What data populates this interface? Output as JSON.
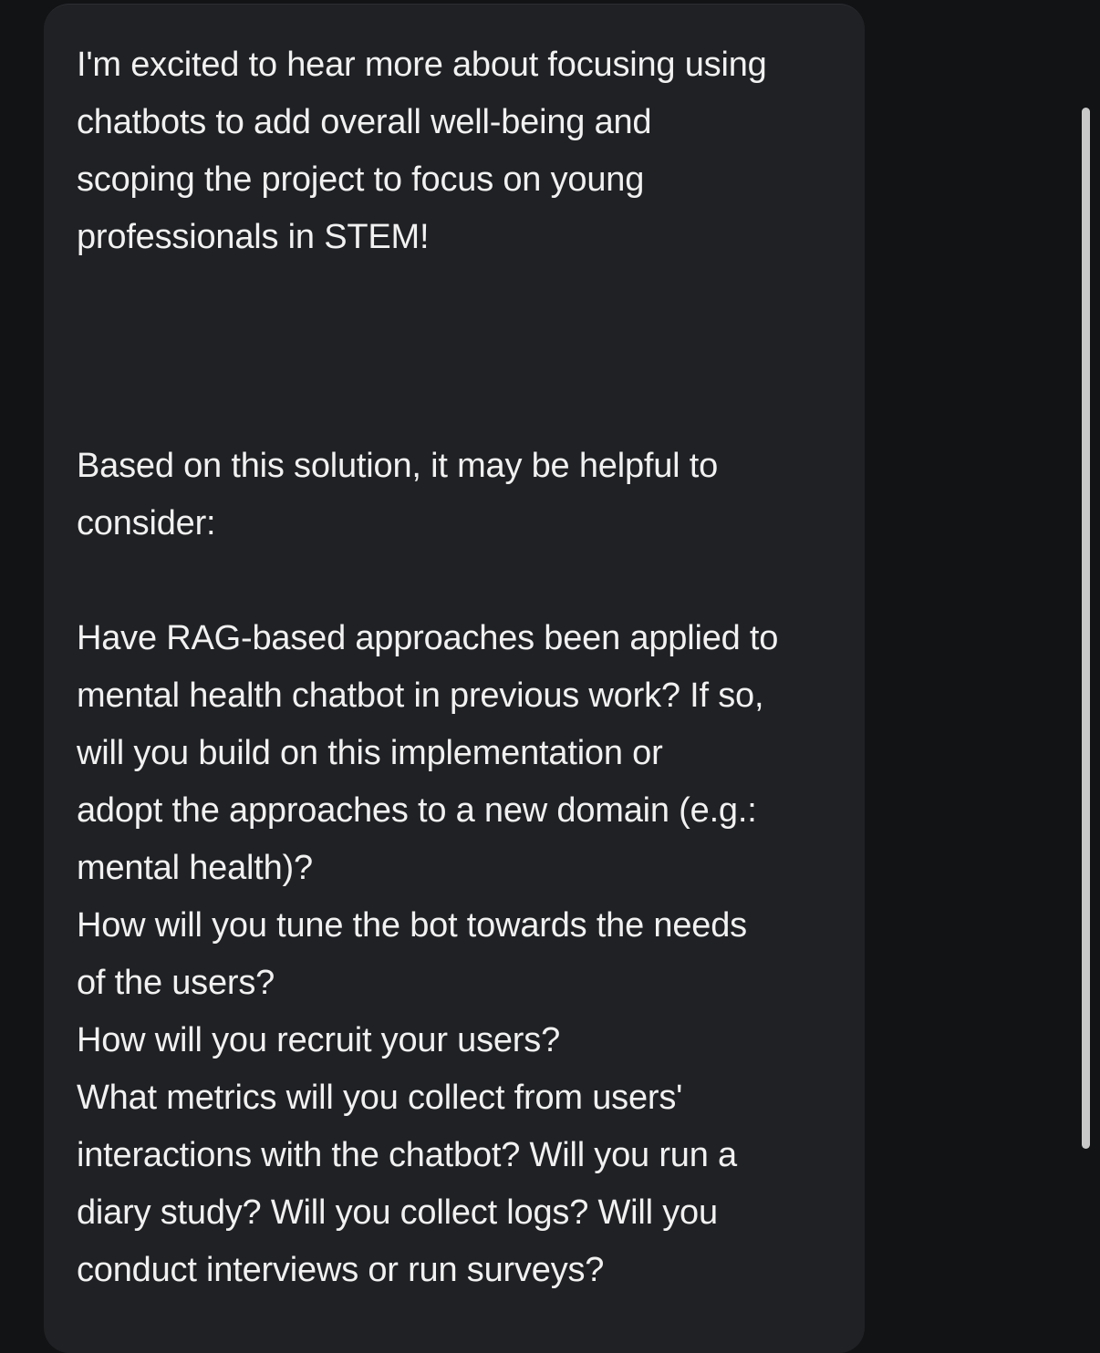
{
  "message": {
    "paragraph_1": [
      "I'm excited to hear more about focusing using",
      "chatbots to add overall well-being and",
      "scoping the project to focus on young",
      "professionals in STEM!"
    ],
    "paragraph_2": [
      "Based on this solution, it may be helpful to",
      "consider:"
    ],
    "paragraph_3": [
      "Have RAG-based approaches been applied to",
      "mental health chatbot in previous work? If so,",
      "will you build on this implementation or",
      "adopt the approaches to a new domain (e.g.:",
      "mental health)?",
      "How will you tune the bot towards the needs",
      "of the users?",
      "How will you recruit your users?",
      "What metrics will you collect from users'",
      "interactions with the chatbot? Will you run a",
      "diary study? Will you collect logs? Will you",
      "conduct interviews or run surveys?"
    ]
  },
  "colors": {
    "background": "#111315",
    "card": "#202124",
    "text": "#f1f1f1",
    "scrollbar": "#c8c8c8"
  }
}
